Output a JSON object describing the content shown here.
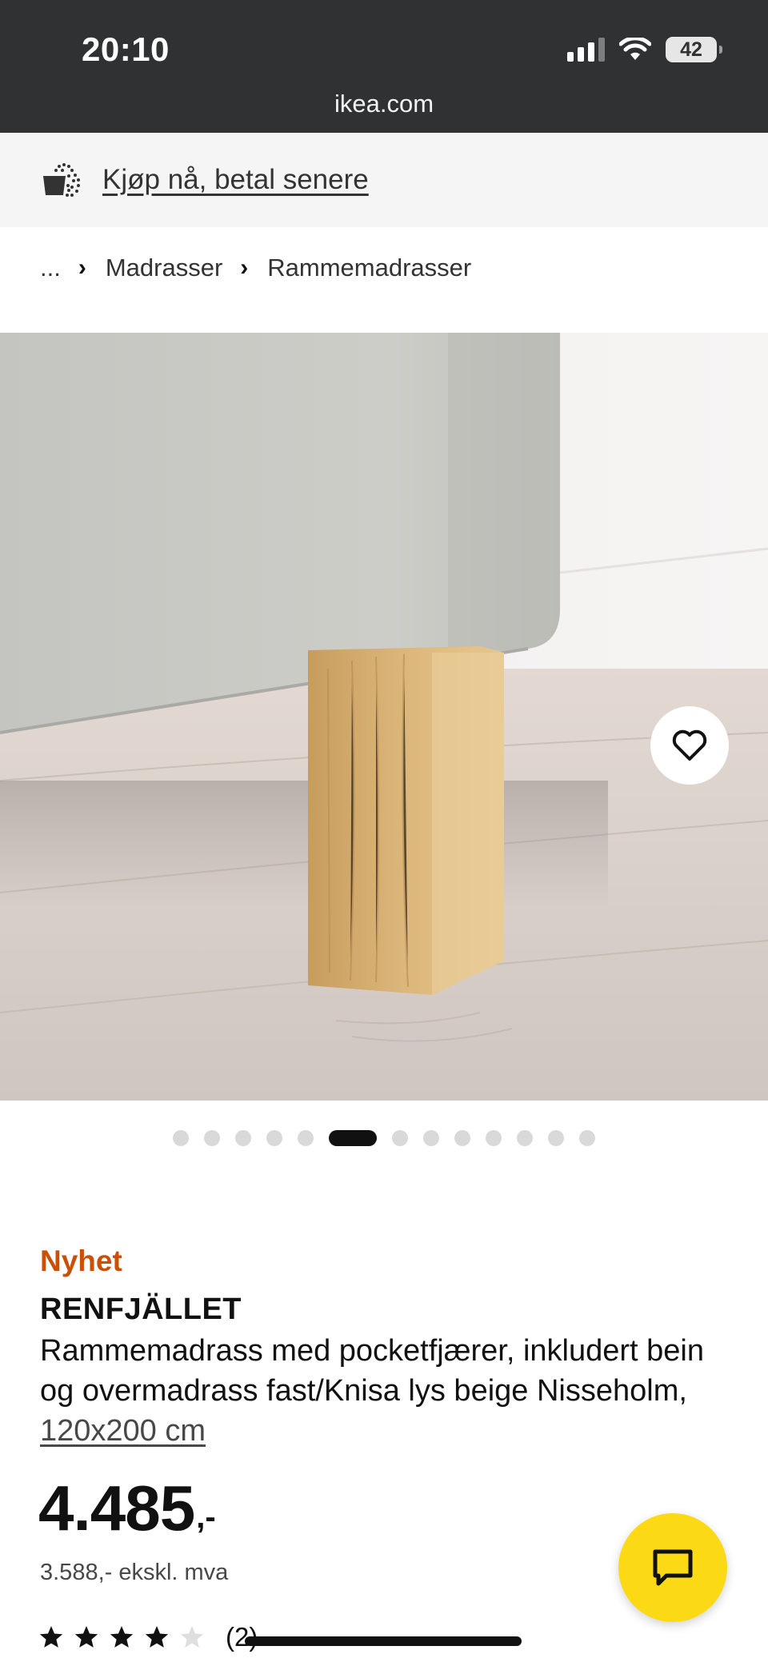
{
  "status_bar": {
    "time": "20:10",
    "battery_level": "42",
    "signal_bars_active": 3,
    "signal_bars_total": 4
  },
  "browser": {
    "url": "ikea.com"
  },
  "pay_later": {
    "icon": "shopping-basket-icon",
    "link_text": "Kjøp nå, betal senere"
  },
  "breadcrumb": {
    "ellipsis": "...",
    "items": [
      "Madrasser",
      "Rammemadrasser"
    ]
  },
  "gallery": {
    "favorite_icon": "heart-icon",
    "total_images": 13,
    "active_index": 5
  },
  "product": {
    "badge": "Nyhet",
    "name": "RENFJÄLLET",
    "description": "Rammemadrass med pocketfjærer, inkludert bein og overmadrass fast/Knisa lys beige Nisseholm, ",
    "size_link": "120x200 cm",
    "price": "4.485",
    "price_suffix": ",-",
    "price_ex_vat": "3.588,- ekskl. mva",
    "rating": 4,
    "rating_max": 5,
    "rating_count": "(2)"
  },
  "chat": {
    "icon": "chat-bubble-icon"
  },
  "colors": {
    "top_bar": "#2f3133",
    "badge_new": "#ca5008",
    "chat_button": "#fbd914"
  }
}
